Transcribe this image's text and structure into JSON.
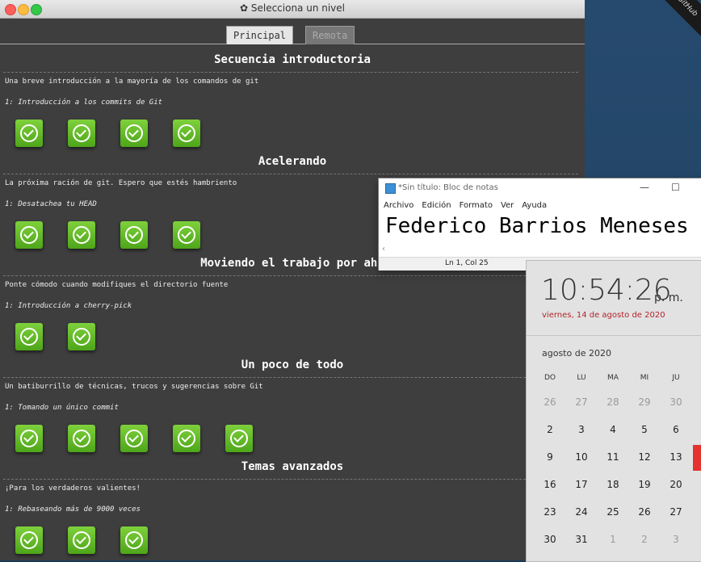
{
  "desktop": {
    "ribbon_text": "GitHub"
  },
  "git_window": {
    "title": "Selecciona un nivel",
    "title_icon": "gear-icon",
    "tabs": [
      {
        "label": "Principal",
        "active": true
      },
      {
        "label": "Remota",
        "active": false
      }
    ],
    "sections": [
      {
        "title": "Secuencia introductoria",
        "description": "Una breve introducción a la mayoría de los comandos de git",
        "level_name": "1: Introducción a los commits de Git",
        "levels": 4
      },
      {
        "title": "Acelerando",
        "description": "La próxima ración de git. Espero que estés hambriento",
        "level_name": "1: Desatachea tu HEAD",
        "levels": 4
      },
      {
        "title": "Moviendo el trabajo por ahí",
        "description": "Ponte cómodo cuando modifiques el directorio fuente",
        "level_name": "1: Introducción a cherry-pick",
        "levels": 2
      },
      {
        "title": "Un poco de todo",
        "description": "Un batiburrillo de técnicas, trucos y sugerencias sobre Git",
        "level_name": "1: Tomando un único commit",
        "levels": 5
      },
      {
        "title": "Temas avanzados",
        "description": "¡Para los verdaderos valientes!",
        "level_name": "1: Rebaseando más de 9000 veces",
        "levels": 3
      }
    ]
  },
  "notepad": {
    "title": "*Sin título: Bloc de notas",
    "menu": [
      "Archivo",
      "Edición",
      "Formato",
      "Ver",
      "Ayuda"
    ],
    "content": "Federico Barrios Meneses",
    "status": "Ln 1, Col 25",
    "controls": [
      "—",
      "☐"
    ]
  },
  "calendar": {
    "time": "10:54:26",
    "ampm": "p. m.",
    "date": "viernes, 14 de agosto de 2020",
    "month": "agosto de 2020",
    "weekdays": [
      "DO",
      "LU",
      "MA",
      "MI",
      "JU"
    ],
    "weeks": [
      [
        "26",
        "27",
        "28",
        "29",
        "30"
      ],
      [
        "2",
        "3",
        "4",
        "5",
        "6"
      ],
      [
        "9",
        "10",
        "11",
        "12",
        "13"
      ],
      [
        "16",
        "17",
        "18",
        "19",
        "20"
      ],
      [
        "23",
        "24",
        "25",
        "26",
        "27"
      ],
      [
        "30",
        "31",
        "1",
        "2",
        "3"
      ]
    ],
    "dim_first_row": true,
    "dim_last_row_from": 2,
    "today_color": "#e4322f"
  },
  "colors": {
    "level_green": "#5eb626",
    "panel_bg": "#3e3e3e",
    "date_red": "#b3242a"
  }
}
